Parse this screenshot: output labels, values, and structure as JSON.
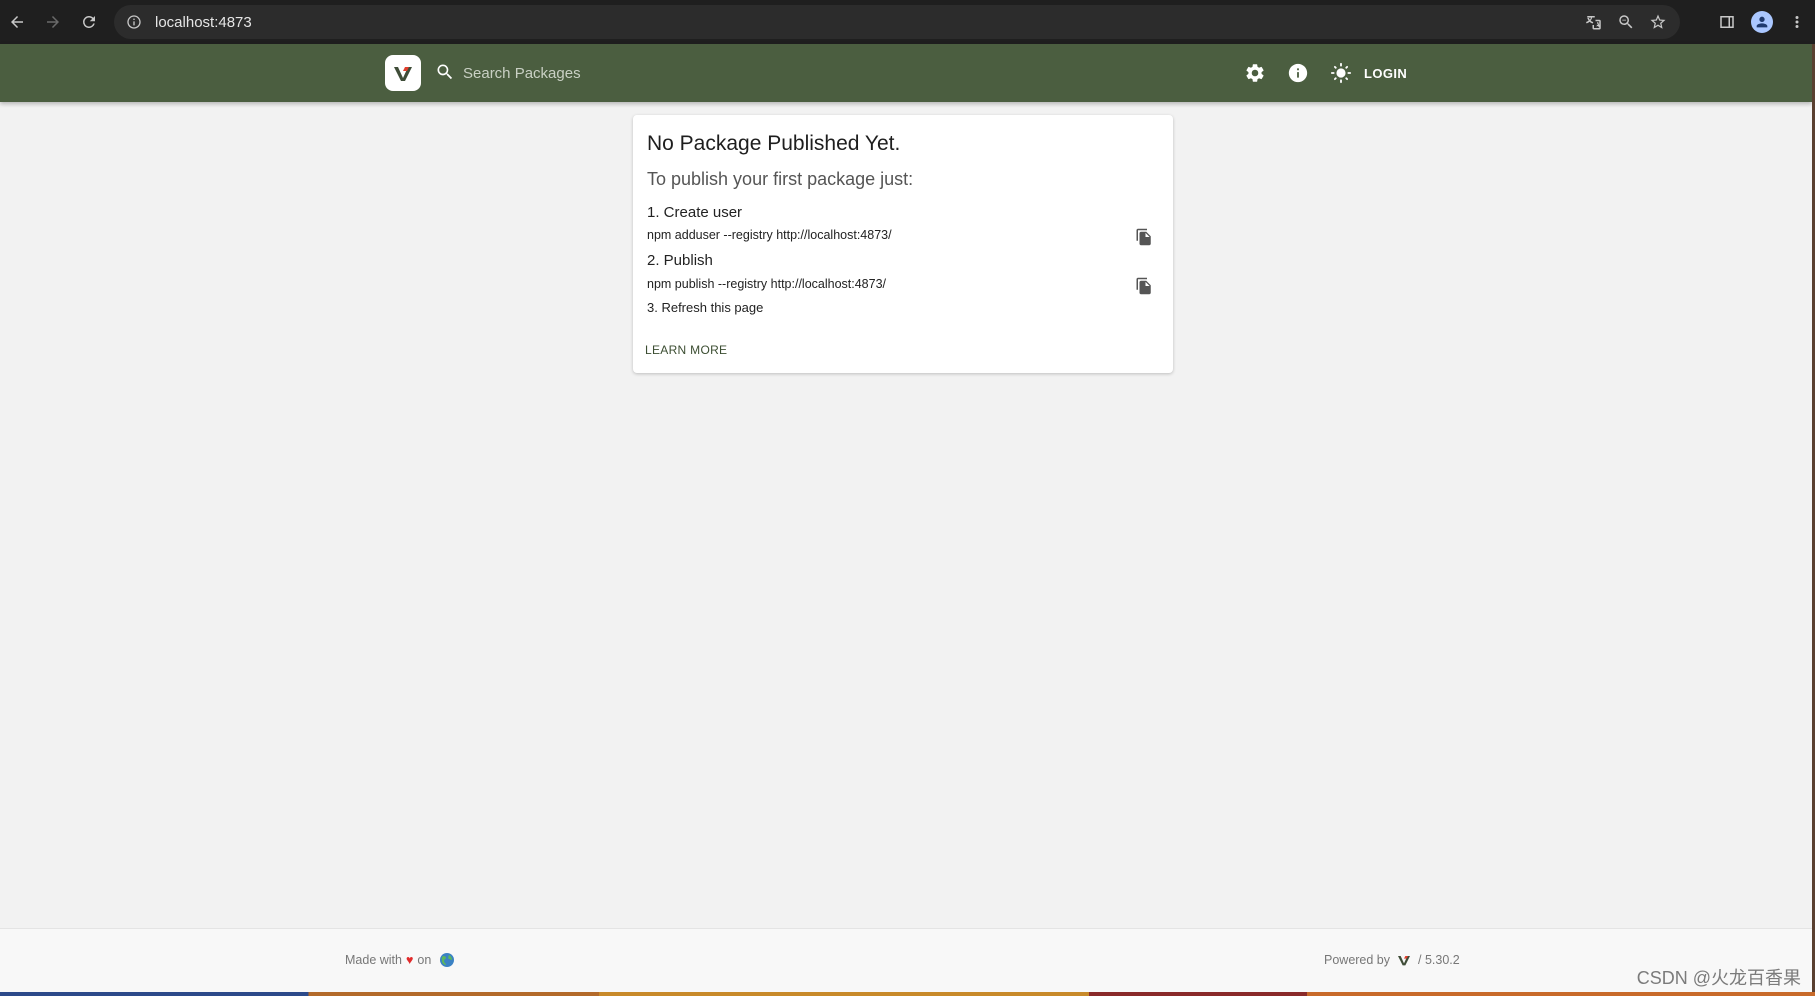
{
  "browser": {
    "url": "localhost:4873"
  },
  "header": {
    "search_placeholder": "Search Packages",
    "login_label": "LOGIN",
    "color": "#4b5e40"
  },
  "card": {
    "title": "No Package Published Yet.",
    "subtitle": "To publish your first package just:",
    "step1": "1. Create user",
    "cmd1": "npm adduser --registry http://localhost:4873/",
    "step2": "2. Publish",
    "cmd2": "npm publish --registry http://localhost:4873/",
    "step3": "3. Refresh this page",
    "learn_more": "LEARN MORE"
  },
  "footer": {
    "made_with": "Made with",
    "heart": "♥",
    "on": "on",
    "powered_by": "Powered by",
    "version": "/ 5.30.2"
  },
  "watermark": "CSDN @火龙百香果",
  "icons": [
    "back-icon",
    "forward-icon",
    "reload-icon",
    "info-icon",
    "translate-icon",
    "zoom-icon",
    "star-icon",
    "sidepanel-icon",
    "profile-icon",
    "menu-icon",
    "verdaccio-logo-icon",
    "search-icon",
    "settings-icon",
    "info-circle-icon",
    "light-mode-icon",
    "copy-icon",
    "globe-icon"
  ]
}
